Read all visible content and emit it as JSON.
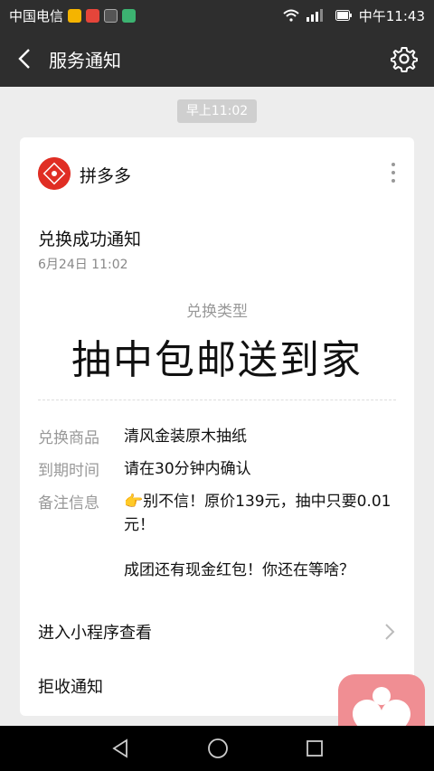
{
  "status_bar": {
    "carrier": "中国电信",
    "time": "中午11:43",
    "icons": [
      "weibo-icon",
      "message-icon",
      "app-icon",
      "wifi-icon",
      "signal-icon",
      "battery-icon"
    ]
  },
  "nav": {
    "title": "服务通知",
    "back_icon": "chevron-left-icon",
    "settings_icon": "gear-icon"
  },
  "timestamp": "早上11:02",
  "card": {
    "brand": "拼多多",
    "title": "兑换成功通知",
    "date": "6月24日  11:02",
    "type_label": "兑换类型",
    "type_value": "抽中包邮送到家",
    "fields": [
      {
        "label": "兑换商品",
        "value": "清风金装原木抽纸"
      },
      {
        "label": "到期时间",
        "value": "请在30分钟内确认"
      },
      {
        "label": "备注信息",
        "value": "👉别不信！原价139元，抽中只要0.01元！",
        "extra": "成团还有现金红包！你还在等啥？"
      }
    ],
    "view_link": "进入小程序查看",
    "reject_link": "拒收通知"
  },
  "colors": {
    "bar": "#2e2e2e",
    "background": "#ededed",
    "brand_red": "#e02e24",
    "floating_app": "#f08e93"
  }
}
